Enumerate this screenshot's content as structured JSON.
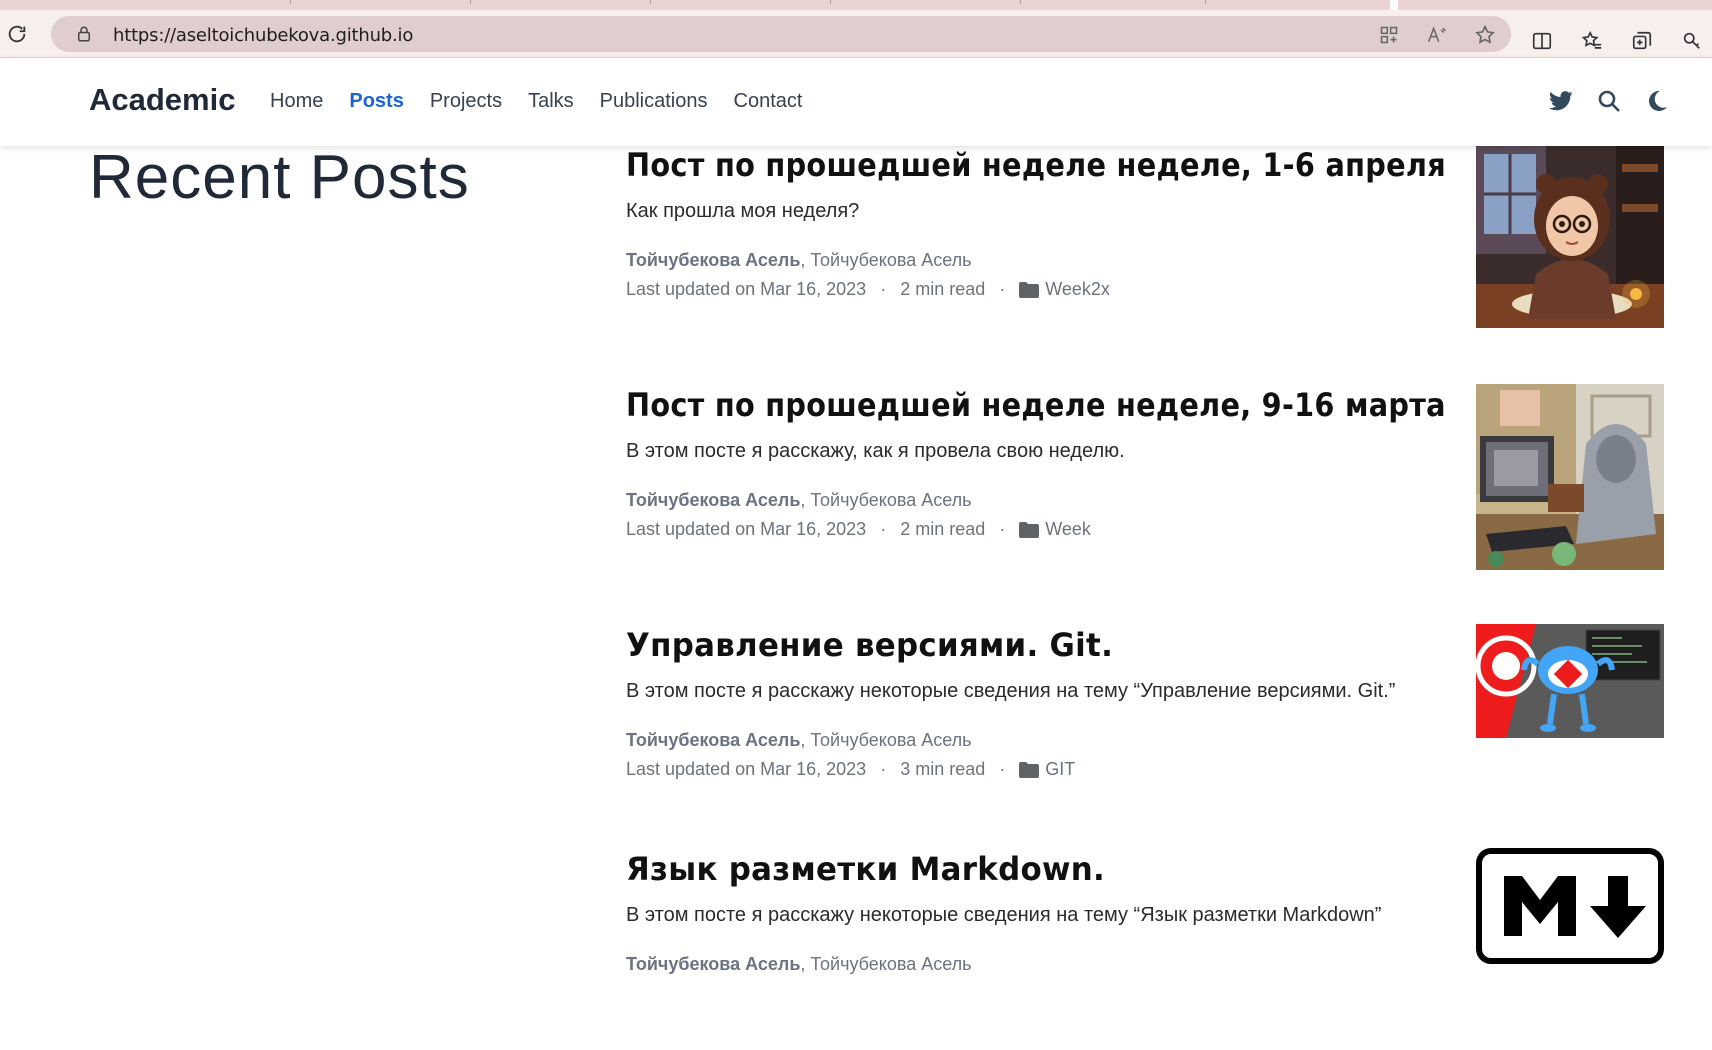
{
  "browser": {
    "url": "https://aseltoichubekova.github.io"
  },
  "navbar": {
    "brand": "Academic",
    "links": [
      {
        "label": "Home",
        "active": false
      },
      {
        "label": "Posts",
        "active": true
      },
      {
        "label": "Projects",
        "active": false
      },
      {
        "label": "Talks",
        "active": false
      },
      {
        "label": "Publications",
        "active": false
      },
      {
        "label": "Contact",
        "active": false
      }
    ],
    "tools": [
      "twitter-icon",
      "search-icon",
      "moon-icon"
    ],
    "accent": "#1e63d6"
  },
  "page": {
    "title": "Recent Posts"
  },
  "posts": [
    {
      "title": "Пост по прошедшей неделе неделе, 1-6 апреля",
      "summary": "Как прошла моя неделя?",
      "author_main": "Тойчубекова Асель",
      "author_sep": ",",
      "author_second": " Тойчубекова Асель",
      "updated": "Last updated on Mar 16, 2023",
      "read_time": "2 min read",
      "category": "Week2x",
      "thumb": "girl-with-glasses-illustration"
    },
    {
      "title": "Пост по прошедшей неделе неделе, 9-16 марта",
      "summary": "В этом посте я расскажу, как я провела свою неделю.",
      "author_main": "Тойчубекова Асель",
      "author_sep": ",",
      "author_second": " Тойчубекова Асель",
      "updated": "Last updated on Mar 16, 2023",
      "read_time": "2 min read",
      "category": "Week",
      "thumb": "person-at-computer-illustration"
    },
    {
      "title": "Управление версиями. Git.",
      "summary": "В этом посте я расскажу некоторые сведения на тему “Управление версиями. Git.”",
      "author_main": "Тойчубекова Асель",
      "author_sep": ",",
      "author_second": " Тойчубекова Асель",
      "updated": "Last updated on Mar 16, 2023",
      "read_time": "3 min read",
      "category": "GIT",
      "thumb": "git-octocat-illustration"
    },
    {
      "title": "Язык разметки Markdown.",
      "summary": "В этом посте я расскажу некоторые сведения на тему “Язык разметки Markdown”",
      "author_main": "Тойчубекова Асель",
      "author_sep": ",",
      "author_second": " Тойчубекова Асель",
      "thumb": "markdown-logo"
    }
  ],
  "meta_separator": "·"
}
